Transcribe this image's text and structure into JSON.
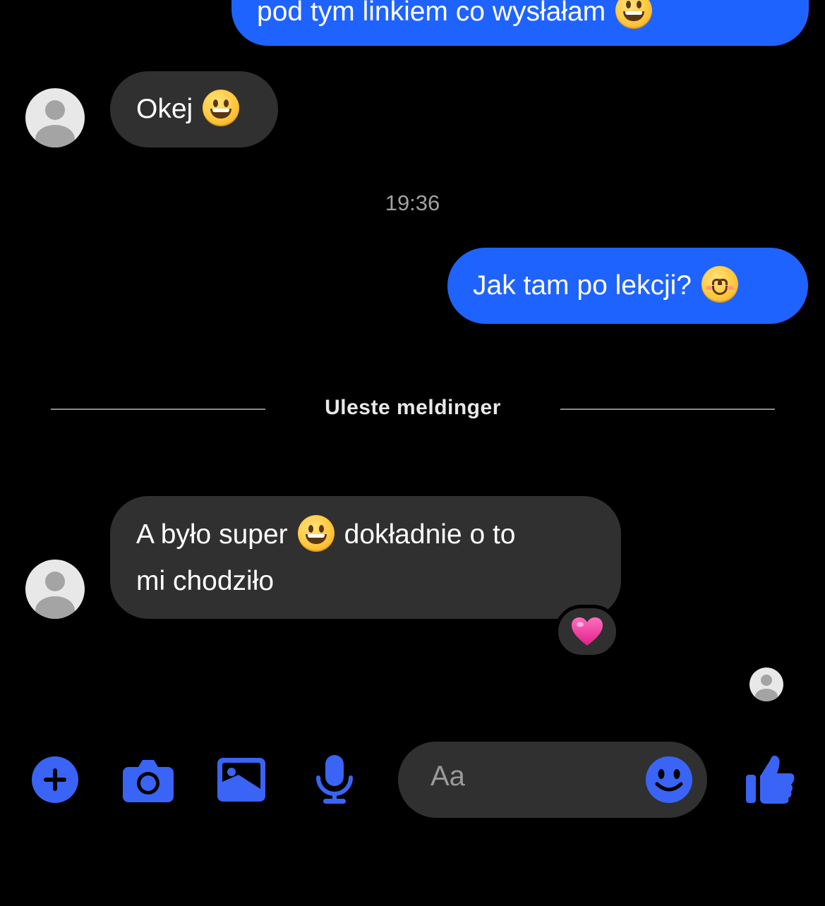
{
  "messages": [
    {
      "id": "m1",
      "direction": "outgoing",
      "text": "pod tym linkiem co wysłałam",
      "emoji": "grinning-face-with-smiling-eyes"
    },
    {
      "id": "m2",
      "direction": "incoming",
      "text": "Okej",
      "emoji": "grinning-face"
    },
    {
      "id": "m3",
      "direction": "outgoing",
      "text": "Jak tam po lekcji?",
      "emoji": "smiling-face-with-smiling-eyes"
    },
    {
      "id": "m4",
      "direction": "incoming",
      "text_before": "A było super",
      "emoji": "grinning-face",
      "text_after": "dokładnie o to",
      "text_line2": "mi chodziło",
      "reaction": "💗"
    }
  ],
  "timestamp": "19:36",
  "unread_divider": "Uleste meldinger",
  "composer": {
    "placeholder": "Aa",
    "icons": [
      "plus-icon",
      "camera-icon",
      "image-icon",
      "microphone-icon",
      "emoji-icon",
      "thumbs-up-icon"
    ]
  },
  "colors": {
    "background": "#000000",
    "outgoing_bubble": "#1f63ff",
    "incoming_bubble": "#303030",
    "accent": "#3a64f5"
  }
}
